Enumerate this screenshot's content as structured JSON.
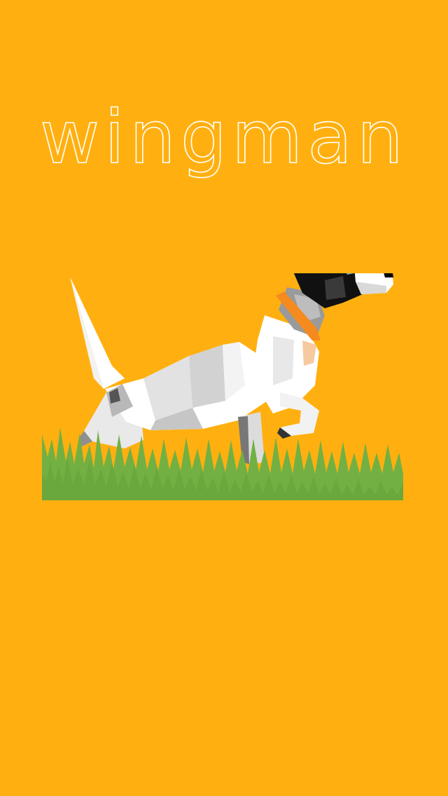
{
  "app": {
    "title": "wingman"
  },
  "colors": {
    "background": "#FFB010",
    "title": "#FFFFFF",
    "grass": "#72B043",
    "collar": "#F58A1F",
    "dog_white": "#FFFFFF",
    "dog_grey": "#CFCFCF",
    "dog_dark": "#111111"
  },
  "illustration": {
    "icon": "dog-in-grass-illustration"
  }
}
